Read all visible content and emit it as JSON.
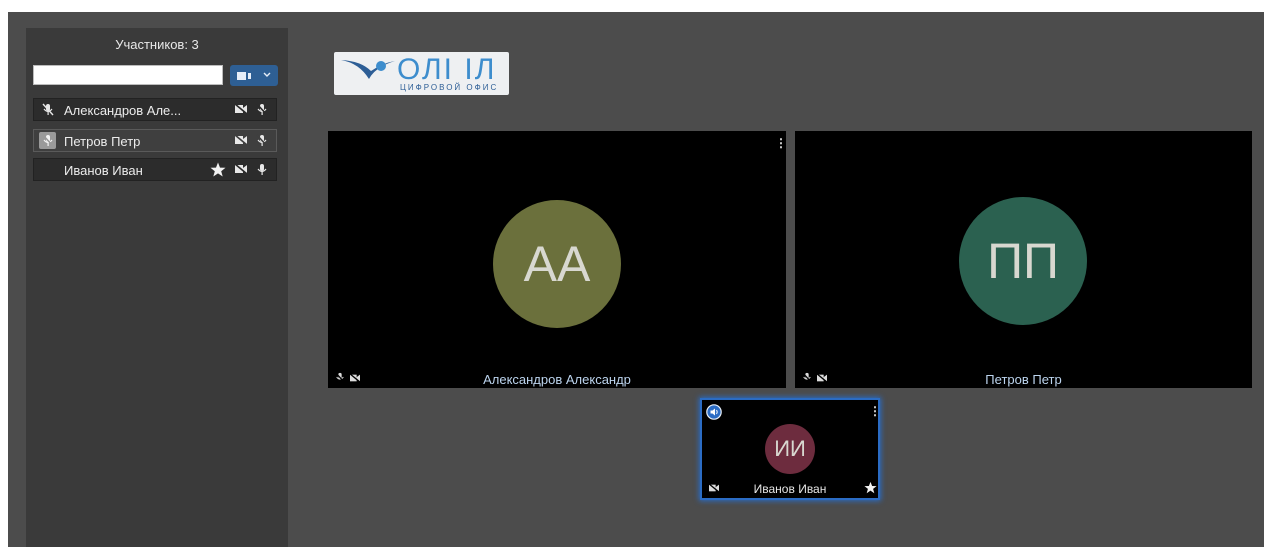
{
  "sidebar": {
    "title": "Участников: 3",
    "search": {
      "value": "",
      "placeholder": ""
    },
    "camera_button_icon": "camera-icon",
    "participants": [
      {
        "name": "Александров Але...",
        "lead_icon": "mic-off-icon",
        "icons": [
          "camera-off-icon",
          "mic-off-icon"
        ],
        "selected": false
      },
      {
        "name": "Петров Петр",
        "lead_icon": "mic-off-icon",
        "icons": [
          "camera-off-icon",
          "mic-off-icon"
        ],
        "selected": true
      },
      {
        "name": "Иванов Иван",
        "lead_icon": "",
        "icons": [
          "star-icon",
          "camera-off-icon",
          "mic-icon"
        ],
        "selected": false
      }
    ]
  },
  "logo": {
    "word": "ОЛІ ІЛ",
    "subtitle": "ЦИФРОВОЙ ОФИС"
  },
  "tiles": [
    {
      "initials": "АА",
      "name": "Александров Александр",
      "avatar_color": "#6b703c"
    },
    {
      "initials": "ПП",
      "name": "Петров Петр",
      "avatar_color": "#2b6150"
    },
    {
      "initials": "ИИ",
      "name": "Иванов Иван",
      "avatar_color": "#6d2c3e",
      "highlight_color": "#2b6cc4"
    }
  ],
  "colors": {
    "background": "#4c4c4c",
    "sidebar": "#3a3a3a",
    "accent": "#2e5f94",
    "tile_label": "#bcd4ee"
  }
}
